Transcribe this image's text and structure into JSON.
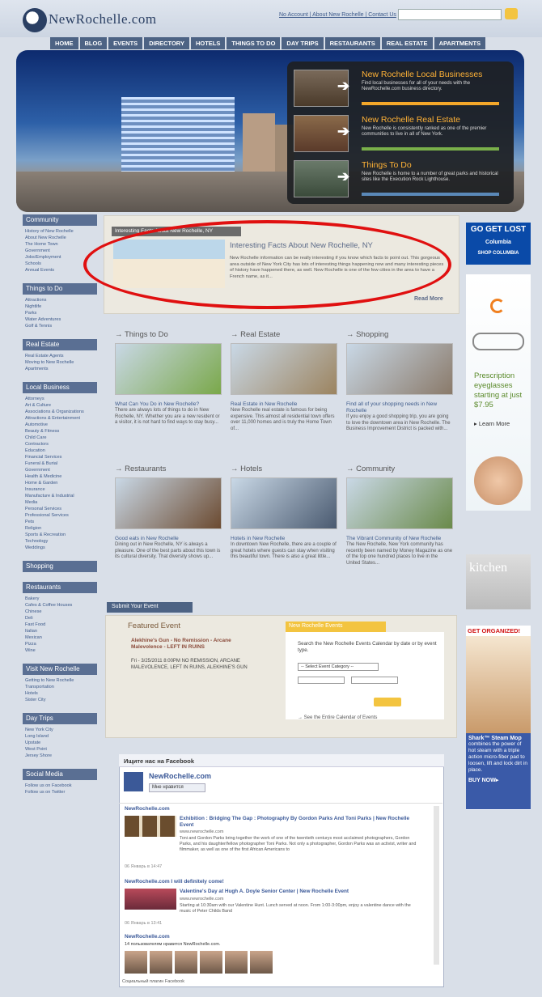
{
  "header": {
    "logo": "NewRochelle.com",
    "links": "No Account | About New Rochelle | Contact Us",
    "search_placeholder": ""
  },
  "nav": [
    "HOME",
    "BLOG",
    "EVENTS",
    "DIRECTORY",
    "HOTELS",
    "THINGS TO DO",
    "DAY TRIPS",
    "RESTAURANTS",
    "REAL ESTATE",
    "APARTMENTS"
  ],
  "promo": [
    {
      "title": "New Rochelle Local Businesses",
      "desc": "Find local businesses for all of your needs with the NewRochelle.com business directory."
    },
    {
      "title": "New Rochelle Real Estate",
      "desc": "New Rochelle is consistently ranked as one of the premier communities to live in all of New York."
    },
    {
      "title": "Things To Do",
      "desc": "New Rochelle is home to a number of great parks and historical sites like the Execution Rock Lighthouse."
    }
  ],
  "sidebar": [
    {
      "title": "Community",
      "links": [
        "History of New Rochelle",
        "About New Rochelle",
        "The Home Town",
        "Government",
        "Jobs/Employment",
        "Schools",
        "Annual Events"
      ]
    },
    {
      "title": "Things to Do",
      "links": [
        "Attractions",
        "Nightlife",
        "Parks",
        "Water Adventures",
        "Golf & Tennis"
      ]
    },
    {
      "title": "Real Estate",
      "links": [
        "Real Estate Agents",
        "Moving to New Rochelle",
        "Apartments"
      ]
    },
    {
      "title": "Local Business",
      "links": [
        "Attorneys",
        "Art & Culture",
        "Associations & Organizations",
        "Attractions & Entertainment",
        "Automotive",
        "Beauty & Fitness",
        "Child Care",
        "Contractors",
        "Education",
        "Financial Services",
        "Funeral & Burial",
        "Government",
        "Health & Medicine",
        "Home & Garden",
        "Insurance",
        "Manufacture & Industrial",
        "Media",
        "Personal Services",
        "Professional Services",
        "Pets",
        "Religion",
        "Sports & Recreation",
        "Technology",
        "Weddings"
      ]
    },
    {
      "title": "Shopping",
      "links": []
    },
    {
      "title": "Restaurants",
      "links": [
        "Bakery",
        "Cafes & Coffee Houses",
        "Chinese",
        "Deli",
        "Fast Food",
        "Italian",
        "Mexican",
        "Pizza",
        "Wine"
      ]
    },
    {
      "title": "Visit New Rochelle",
      "links": [
        "Getting to New Rochelle",
        "Transportation",
        "Hotels",
        "Sister City"
      ]
    },
    {
      "title": "Day Trips",
      "links": [
        "New York City",
        "Long Island",
        "Upstate",
        "West Point",
        "Jersey Shore"
      ]
    },
    {
      "title": "Social Media",
      "links": [
        "Follow us on Facebook",
        "Follow us on Twitter"
      ]
    }
  ],
  "facts": {
    "tab": "Interesting Facts About New Rochelle, NY",
    "title": "Interesting Facts About New Rochelle, NY",
    "desc": "New Rochelle information can be really interesting if you know which facts to point out. This gorgeous area outside of New York City has lots of interesting things happening now and many interesting pieces of history have happened there, as well. New Rochelle is one of the few cities in the area to have a French name, as it...",
    "read_more": "Read More"
  },
  "sections": [
    {
      "heading": "→ Things to Do",
      "title": "What Can You Do in New Rochelle?",
      "desc": "There are always lots of things to do in New Rochelle, NY. Whether you are a new resident or a visitor, it is not hard to find ways to stay busy...",
      "color": "#7aa84a"
    },
    {
      "heading": "→ Real Estate",
      "title": "Real Estate in New Rochelle",
      "desc": "New Rochelle real estate is famous for being expensive. This almost all residential town offers over 11,000 homes and is truly the Home Town of...",
      "color": "#9c8460"
    },
    {
      "heading": "→ Shopping",
      "title": "Find all of your shopping needs in New Rochelle",
      "desc": "If you enjoy a good shopping trip, you are going to love the downtown area in New Rochelle. The Business Improvement District is packed with...",
      "color": "#8a7a6a"
    },
    {
      "heading": "→ Restaurants",
      "title": "Good eats in New Rochelle",
      "desc": "Dining out in New Rochelle, NY is always a pleasure. One of the best parts about this town is its cultural diversity. That diversity shows up...",
      "color": "#6b4a30"
    },
    {
      "heading": "→ Hotels",
      "title": "Hotels in New Rochelle",
      "desc": "In downtown New Rochelle, there are a couple of great hotels where guests can stay when visiting this beautiful town. There is also a great little...",
      "color": "#4a5a70"
    },
    {
      "heading": "→ Community",
      "title": "The Vibrant Community of New Rochelle",
      "desc": "The New Rochelle, New York community has recently been named by Money Magazine as one of the top one hundred places to live in the United States...",
      "color": "#6a8a4a"
    }
  ],
  "events": {
    "submit": "Submit Your Event",
    "featured_title": "Featured Event",
    "event_name": "Alekhine's Gun - No Remission - Arcane Malevolence - LEFT IN RUINS",
    "event_date": "Fri - 3/25/2011 8:00PM NO REMISSION, ARCANE MALEVOLENCE, LEFT IN RUINS, ALEKHINE'S GUN",
    "tab": "New Rochelle Events",
    "desc": "Search the New Rochelle Events Calendar by date or by event type.",
    "select": "-- Select Event Category --",
    "see_all": "→ See the Entire Calendar of Events"
  },
  "facebook": {
    "header": "Ищите нас на Facebook",
    "page": "NewRochelle.com",
    "like": "Мне нравится",
    "post1": {
      "src": "NewRochelle.com",
      "title": "Exhibition : Bridging The Gap : Photography By Gordon Parks And Toni Parks | New Rochelle Event",
      "url": "www.newrochelle.com",
      "body": "Toni and Gordon Parks bring together the work of one of the twentieth centurys most acclaimed photographers, Gordon Parks, and his daughter/fellow photographer Toni Parks. Not only a photographer, Gordon Parks was an activist, writer and filmmaker, as well as one of the first African Americans to",
      "date": "06 Январь в 14:47"
    },
    "post2": {
      "src": "NewRochelle.com I will definitely come!",
      "title": "Valentine's Day at Hugh A. Doyle Senior Center | New Rochelle Event",
      "url": "www.newrochelle.com",
      "body": "Starting at 10:30am with our Valentine Hunt. Lunch served at noon. From 1:00-3:00pm, enjoy a valentine dance with the music of Peter Childs Band",
      "date": "06 Январь в 13:41"
    },
    "post3": {
      "src": "NewRochelle.com"
    },
    "fans": "14 пользователям нравится NewRochelle.com.",
    "footer": "Социальный плагин Facebook"
  },
  "ads": {
    "gol": "GO GET LOST",
    "gol_brand": "Columbia",
    "gol_shop": "SHOP COLUMBIA",
    "eye_text": "Prescription eyeglasses starting at just $7.95",
    "eye_learn": "▸ Learn More",
    "kitchen": "kitchen",
    "shark_head": "GET ORGANIZED!",
    "shark_title": "Shark™ Steam Mop",
    "shark_desc": "combines the power of hot steam with a triple action micro-fiber pad to loosen, lift and lock dirt in place.",
    "shark_buy": "BUY NOW▸"
  }
}
